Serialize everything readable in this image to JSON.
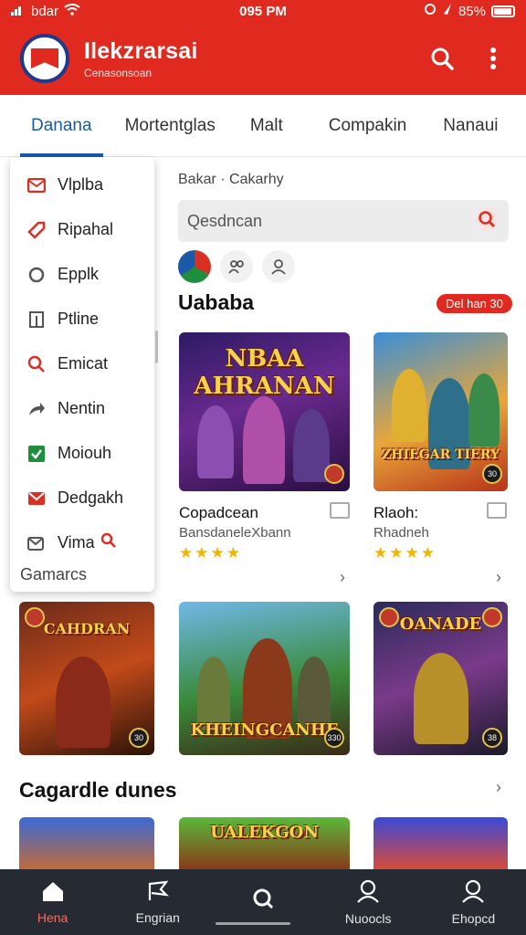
{
  "status_bar": {
    "carrier": "bdar",
    "time": "095 PM",
    "battery": "85%"
  },
  "header": {
    "title": "Ilekzrarsai",
    "subtitle": "Cenasonsoan"
  },
  "tabs": [
    {
      "label": "Danana",
      "active": true
    },
    {
      "label": "Mortentglas"
    },
    {
      "label": "Malt"
    },
    {
      "label": "Compakin"
    },
    {
      "label": "Nanaui"
    }
  ],
  "menu": {
    "items": [
      {
        "label": "Vlplba",
        "icon": "envelope-icon",
        "color": "#d93025"
      },
      {
        "label": "Ripahal",
        "icon": "tag-icon",
        "color": "#d93025"
      },
      {
        "label": "Epplk",
        "icon": "circle-icon",
        "color": "#555555"
      },
      {
        "label": "Ptline",
        "icon": "doc-icon",
        "color": "#555555"
      },
      {
        "label": "Emicat",
        "icon": "search-icon",
        "color": "#d93025"
      },
      {
        "label": "Nentin",
        "icon": "share-icon",
        "color": "#555555"
      },
      {
        "label": "Moiouh",
        "icon": "check-icon",
        "color": "#1e8e3e"
      },
      {
        "label": "Dedgakh",
        "icon": "mail-icon",
        "color": "#d93025"
      },
      {
        "label": "Vima",
        "icon": "mail-search-icon",
        "color": "#555555"
      }
    ],
    "footer": "Gamarcs"
  },
  "breadcrumb": "Bakar · Cakarhy",
  "search": {
    "placeholder": "Qesdncan"
  },
  "section1": {
    "title": "Uababa",
    "badge": "Del han 30"
  },
  "cards": [
    {
      "title": "Copadcean",
      "subtitle": "BansdaneleXbann",
      "rating": "★★★★",
      "art": "NBAA AHRANAN",
      "badge": ""
    },
    {
      "title": "Rlaoh:",
      "subtitle": "Rhadneh",
      "rating": "★★★★",
      "art": "ZHIEGAR TIERY",
      "badge": "30"
    },
    {
      "art": "CAHDRAN",
      "badge": "30"
    },
    {
      "art": "KHEINGCANHE",
      "badge": "330"
    },
    {
      "art": "OANADE",
      "badge": "38"
    },
    {
      "art": "UALEKGON"
    }
  ],
  "section2": {
    "title": "Cagardle dunes"
  },
  "bottom_nav": [
    {
      "label": "Hena",
      "icon": "home-icon",
      "active": true
    },
    {
      "label": "Engrian",
      "icon": "flag-icon"
    },
    {
      "label": "",
      "icon": "search-icon"
    },
    {
      "label": "Nuoocls",
      "icon": "profile-icon"
    },
    {
      "label": "Ehopcd",
      "icon": "user-icon"
    }
  ],
  "colors": {
    "brand": "#e02a1f",
    "accent": "#1a5aa8",
    "nav_bg": "#262a32",
    "stars": "#f4b400"
  }
}
